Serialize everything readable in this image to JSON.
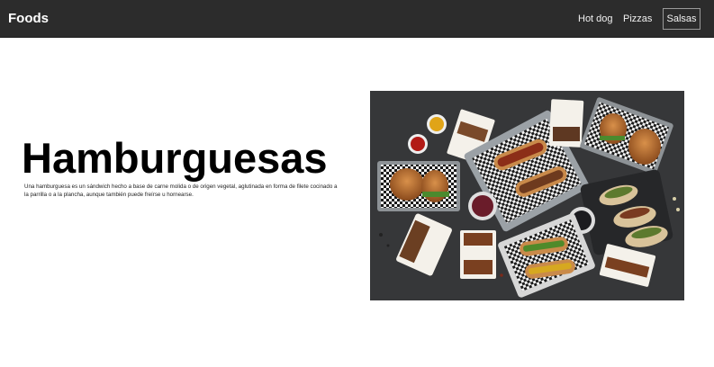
{
  "navbar": {
    "brand": "Foods",
    "links": [
      {
        "label": "Hot dog"
      },
      {
        "label": "Pizzas"
      },
      {
        "label": "Salsas",
        "active": true
      }
    ]
  },
  "hero": {
    "title": "Hamburguesas",
    "description": "Una hamburguesa es un sándwich hecho a base de carne molida o de origen vegetal, aglutinada en forma de filete cocinado a la parrilla o a la plancha, aunque también puede freírse u hornearse."
  },
  "image": {
    "subject": "food-photo-burgers-hotdogs-tacos"
  },
  "colors": {
    "navbar_bg": "#2c2c2c",
    "page_bg": "#ffffff",
    "text": "#000000"
  }
}
